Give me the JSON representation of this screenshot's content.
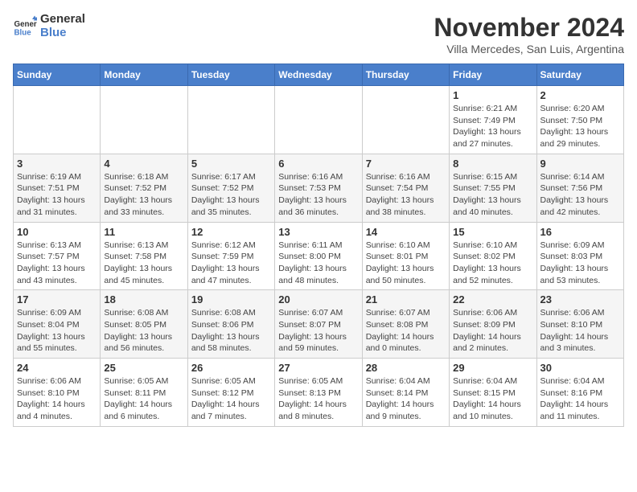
{
  "logo": {
    "line1": "General",
    "line2": "Blue"
  },
  "title": "November 2024",
  "subtitle": "Villa Mercedes, San Luis, Argentina",
  "weekdays": [
    "Sunday",
    "Monday",
    "Tuesday",
    "Wednesday",
    "Thursday",
    "Friday",
    "Saturday"
  ],
  "weeks": [
    [
      {
        "day": "",
        "info": ""
      },
      {
        "day": "",
        "info": ""
      },
      {
        "day": "",
        "info": ""
      },
      {
        "day": "",
        "info": ""
      },
      {
        "day": "",
        "info": ""
      },
      {
        "day": "1",
        "info": "Sunrise: 6:21 AM\nSunset: 7:49 PM\nDaylight: 13 hours\nand 27 minutes."
      },
      {
        "day": "2",
        "info": "Sunrise: 6:20 AM\nSunset: 7:50 PM\nDaylight: 13 hours\nand 29 minutes."
      }
    ],
    [
      {
        "day": "3",
        "info": "Sunrise: 6:19 AM\nSunset: 7:51 PM\nDaylight: 13 hours\nand 31 minutes."
      },
      {
        "day": "4",
        "info": "Sunrise: 6:18 AM\nSunset: 7:52 PM\nDaylight: 13 hours\nand 33 minutes."
      },
      {
        "day": "5",
        "info": "Sunrise: 6:17 AM\nSunset: 7:52 PM\nDaylight: 13 hours\nand 35 minutes."
      },
      {
        "day": "6",
        "info": "Sunrise: 6:16 AM\nSunset: 7:53 PM\nDaylight: 13 hours\nand 36 minutes."
      },
      {
        "day": "7",
        "info": "Sunrise: 6:16 AM\nSunset: 7:54 PM\nDaylight: 13 hours\nand 38 minutes."
      },
      {
        "day": "8",
        "info": "Sunrise: 6:15 AM\nSunset: 7:55 PM\nDaylight: 13 hours\nand 40 minutes."
      },
      {
        "day": "9",
        "info": "Sunrise: 6:14 AM\nSunset: 7:56 PM\nDaylight: 13 hours\nand 42 minutes."
      }
    ],
    [
      {
        "day": "10",
        "info": "Sunrise: 6:13 AM\nSunset: 7:57 PM\nDaylight: 13 hours\nand 43 minutes."
      },
      {
        "day": "11",
        "info": "Sunrise: 6:13 AM\nSunset: 7:58 PM\nDaylight: 13 hours\nand 45 minutes."
      },
      {
        "day": "12",
        "info": "Sunrise: 6:12 AM\nSunset: 7:59 PM\nDaylight: 13 hours\nand 47 minutes."
      },
      {
        "day": "13",
        "info": "Sunrise: 6:11 AM\nSunset: 8:00 PM\nDaylight: 13 hours\nand 48 minutes."
      },
      {
        "day": "14",
        "info": "Sunrise: 6:10 AM\nSunset: 8:01 PM\nDaylight: 13 hours\nand 50 minutes."
      },
      {
        "day": "15",
        "info": "Sunrise: 6:10 AM\nSunset: 8:02 PM\nDaylight: 13 hours\nand 52 minutes."
      },
      {
        "day": "16",
        "info": "Sunrise: 6:09 AM\nSunset: 8:03 PM\nDaylight: 13 hours\nand 53 minutes."
      }
    ],
    [
      {
        "day": "17",
        "info": "Sunrise: 6:09 AM\nSunset: 8:04 PM\nDaylight: 13 hours\nand 55 minutes."
      },
      {
        "day": "18",
        "info": "Sunrise: 6:08 AM\nSunset: 8:05 PM\nDaylight: 13 hours\nand 56 minutes."
      },
      {
        "day": "19",
        "info": "Sunrise: 6:08 AM\nSunset: 8:06 PM\nDaylight: 13 hours\nand 58 minutes."
      },
      {
        "day": "20",
        "info": "Sunrise: 6:07 AM\nSunset: 8:07 PM\nDaylight: 13 hours\nand 59 minutes."
      },
      {
        "day": "21",
        "info": "Sunrise: 6:07 AM\nSunset: 8:08 PM\nDaylight: 14 hours\nand 0 minutes."
      },
      {
        "day": "22",
        "info": "Sunrise: 6:06 AM\nSunset: 8:09 PM\nDaylight: 14 hours\nand 2 minutes."
      },
      {
        "day": "23",
        "info": "Sunrise: 6:06 AM\nSunset: 8:10 PM\nDaylight: 14 hours\nand 3 minutes."
      }
    ],
    [
      {
        "day": "24",
        "info": "Sunrise: 6:06 AM\nSunset: 8:10 PM\nDaylight: 14 hours\nand 4 minutes."
      },
      {
        "day": "25",
        "info": "Sunrise: 6:05 AM\nSunset: 8:11 PM\nDaylight: 14 hours\nand 6 minutes."
      },
      {
        "day": "26",
        "info": "Sunrise: 6:05 AM\nSunset: 8:12 PM\nDaylight: 14 hours\nand 7 minutes."
      },
      {
        "day": "27",
        "info": "Sunrise: 6:05 AM\nSunset: 8:13 PM\nDaylight: 14 hours\nand 8 minutes."
      },
      {
        "day": "28",
        "info": "Sunrise: 6:04 AM\nSunset: 8:14 PM\nDaylight: 14 hours\nand 9 minutes."
      },
      {
        "day": "29",
        "info": "Sunrise: 6:04 AM\nSunset: 8:15 PM\nDaylight: 14 hours\nand 10 minutes."
      },
      {
        "day": "30",
        "info": "Sunrise: 6:04 AM\nSunset: 8:16 PM\nDaylight: 14 hours\nand 11 minutes."
      }
    ]
  ]
}
